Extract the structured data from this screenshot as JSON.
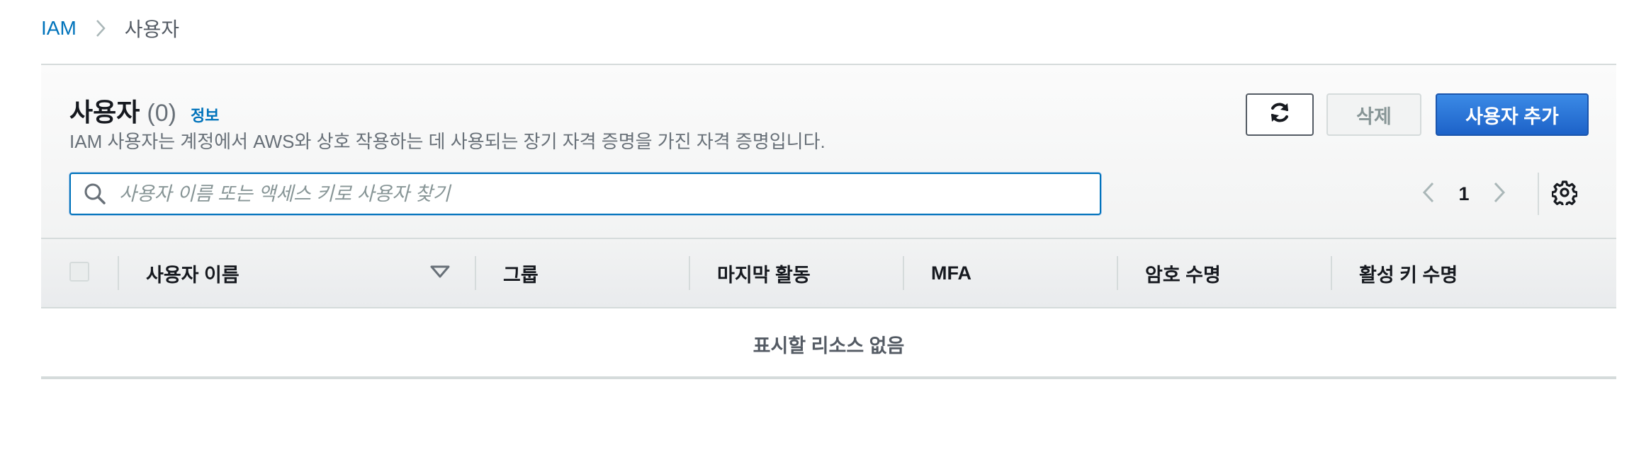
{
  "breadcrumb": {
    "root": "IAM",
    "current": "사용자"
  },
  "panel": {
    "title": "사용자",
    "count": "(0)",
    "info": "정보",
    "description": "IAM 사용자는 계정에서 AWS와 상호 작용하는 데 사용되는 장기 자격 증명을 가진 자격 증명입니다."
  },
  "actions": {
    "refresh_icon": "refresh-icon",
    "delete_label": "삭제",
    "add_label": "사용자 추가"
  },
  "search": {
    "placeholder": "사용자 이름 또는 액세스 키로 사용자 찾기",
    "value": ""
  },
  "pagination": {
    "current_page": "1"
  },
  "table": {
    "columns": [
      "사용자 이름",
      "그룹",
      "마지막 활동",
      "MFA",
      "암호 수명",
      "활성 키 수명"
    ],
    "empty_message": "표시할 리소스 없음"
  },
  "colors": {
    "link": "#0073bb",
    "primary_button": "#1d62c8",
    "border": "#d5dbdb"
  }
}
